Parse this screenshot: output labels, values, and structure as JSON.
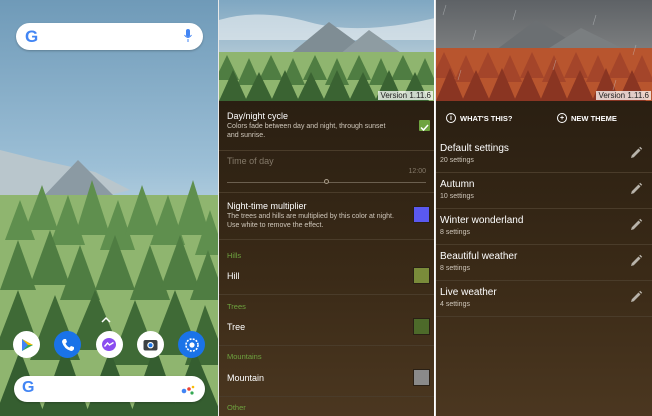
{
  "colors": {
    "panel_bg": "#3a2a17",
    "accent_green": "#6ea33f",
    "night_multiplier": "#5a59f0",
    "hill": "#7a8b3a",
    "tree": "#4d6a2a",
    "mountain": "#8a8a8a"
  },
  "home": {
    "search_logo": "G",
    "bottom_logo": "G",
    "dock_icons": [
      "play-store-icon",
      "phone-icon",
      "messenger-icon",
      "camera-icon",
      "settings-icon"
    ]
  },
  "settings": {
    "version": "Version 1.11.6",
    "day_night": {
      "title": "Day/night cycle",
      "description": "Colors fade between day and night, through sunset and sunrise.",
      "checked": true
    },
    "time_of_day": {
      "label": "Time of day",
      "value": "12:00"
    },
    "night_multiplier": {
      "title": "Night-time multiplier",
      "description": "The trees and hills are multiplied by this color at night. Use white to remove the effect."
    },
    "sections": [
      {
        "header": "Hills",
        "item": "Hill"
      },
      {
        "header": "Trees",
        "item": "Tree"
      },
      {
        "header": "Mountains",
        "item": "Mountain"
      },
      {
        "header": "Other"
      }
    ]
  },
  "themes": {
    "version": "Version 1.11.6",
    "whats_this": "WHAT'S THIS?",
    "new_theme": "NEW THEME",
    "list": [
      {
        "name": "Default settings",
        "count": "20 settings"
      },
      {
        "name": "Autumn",
        "count": "10 settings"
      },
      {
        "name": "Winter wonderland",
        "count": "8 settings"
      },
      {
        "name": "Beautiful weather",
        "count": "8 settings"
      },
      {
        "name": "Live weather",
        "count": "4 settings"
      }
    ]
  }
}
